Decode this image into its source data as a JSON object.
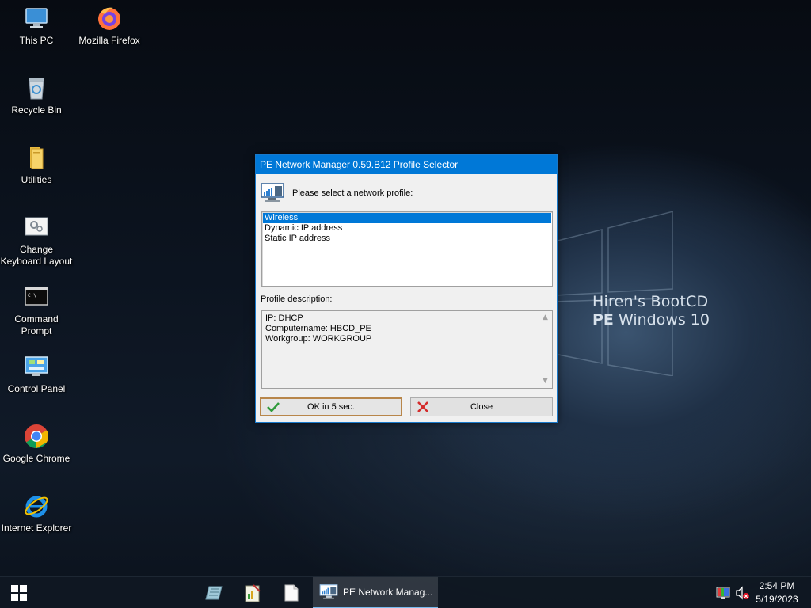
{
  "desktop": {
    "icons": [
      {
        "label": "This PC",
        "icon": "this-pc-icon"
      },
      {
        "label": "Mozilla Firefox",
        "icon": "firefox-icon"
      },
      {
        "label": "Recycle Bin",
        "icon": "recycle-bin-icon"
      },
      {
        "label": "Utilities",
        "icon": "folder-icon"
      },
      {
        "label": "Change Keyboard Layout",
        "icon": "keyboard-settings-icon"
      },
      {
        "label": "Command Prompt",
        "icon": "cmd-icon"
      },
      {
        "label": "Control Panel",
        "icon": "control-panel-icon"
      },
      {
        "label": "Google Chrome",
        "icon": "chrome-icon"
      },
      {
        "label": "Internet Explorer",
        "icon": "ie-icon"
      }
    ],
    "wallpaper": {
      "line1": "Hiren's BootCD",
      "line2_bold": "PE",
      "line2_rest": " Windows 10"
    }
  },
  "dialog": {
    "title": "PE Network Manager 0.59.B12 Profile Selector",
    "prompt": "Please select a network profile:",
    "profiles": [
      "Wireless",
      "Dynamic IP address",
      "Static IP address"
    ],
    "selected_profile": "Wireless",
    "description_label": "Profile description:",
    "description_lines": [
      "IP: DHCP",
      "Computername: HBCD_PE",
      "Workgroup: WORKGROUP"
    ],
    "ok_label": "OK in 5 sec.",
    "close_label": "Close"
  },
  "taskbar": {
    "pinned": [
      "notepad-icon",
      "task-editor-icon",
      "blank-file-icon"
    ],
    "active_app": {
      "label": "PE Network Manag...",
      "icon": "network-manager-icon"
    },
    "tray": [
      "color-icon",
      "volume-muted-icon"
    ],
    "time": "2:54 PM",
    "date": "5/19/2023"
  },
  "colors": {
    "accent": "#0078d7",
    "selection": "#0078d7",
    "default_button_border": "#b8864a"
  }
}
